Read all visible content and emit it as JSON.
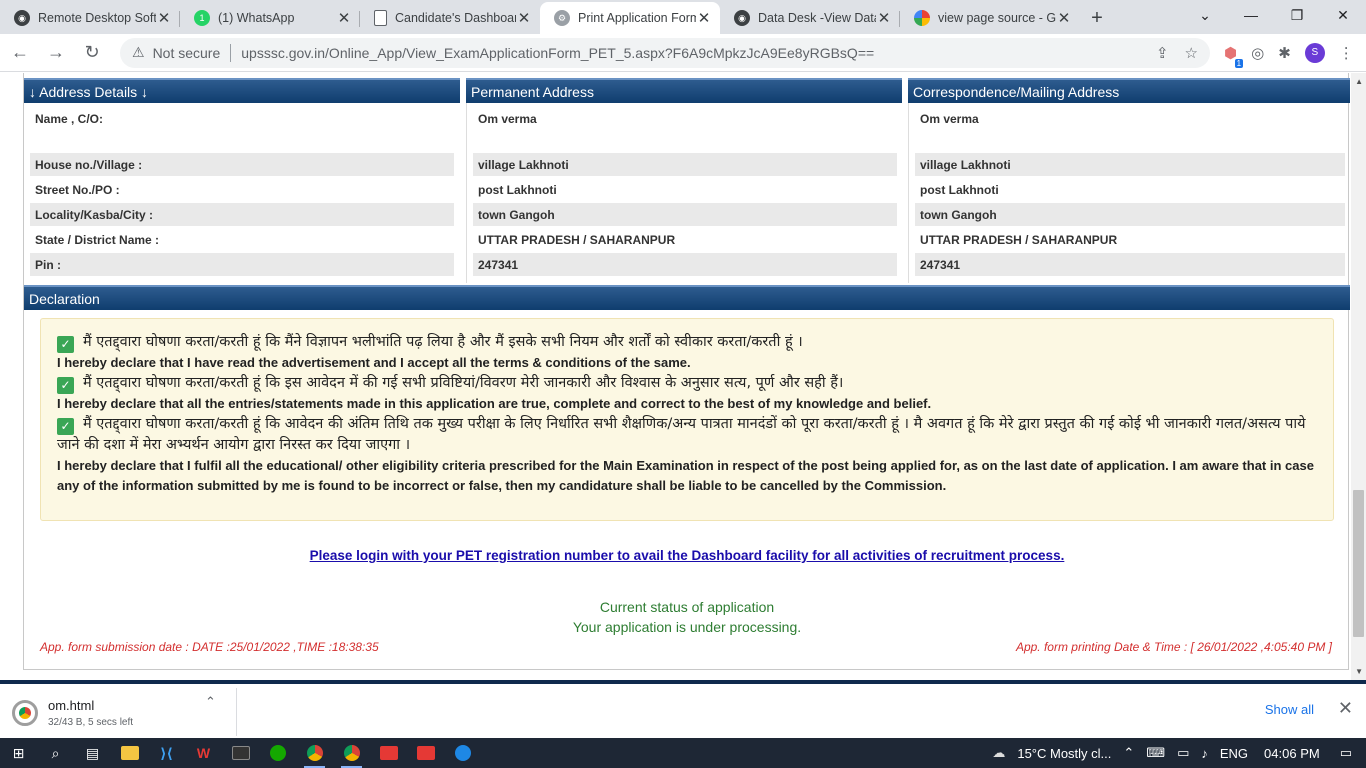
{
  "browser": {
    "tabs": [
      {
        "title": "Remote Desktop Softw",
        "icon": "remote-desktop-icon",
        "color": "#3c4043"
      },
      {
        "title": "(1) WhatsApp",
        "icon": "whatsapp-icon",
        "color": "#25d366"
      },
      {
        "title": "Candidate's Dashboar",
        "icon": "document-icon",
        "color": "#5f6368"
      },
      {
        "title": "Print Application Form",
        "icon": "print-app-icon",
        "color": "#5f6368"
      },
      {
        "title": "Data Desk -View Data",
        "icon": "remote-desktop-icon",
        "color": "#3c4043"
      },
      {
        "title": "view page source - Go",
        "icon": "google-icon",
        "color": "#4285f4"
      }
    ],
    "active_tab": 3,
    "new_tab": "+",
    "not_secure": "Not secure",
    "url": "upsssc.gov.in/Online_App/View_ExamApplicationForm_PET_5.aspx?F6A9cMpkzJcA9Ee8yRGBsQ==",
    "profile_initial": "S",
    "extension_badge": "1"
  },
  "address": {
    "headers": {
      "labels": "↓ Address Details ↓",
      "permanent": "Permanent Address",
      "correspondence": "Correspondence/Mailing Address"
    },
    "labels": [
      "Name , C/O:",
      "House no./Village :",
      "Street No./PO :",
      "Locality/Kasba/City :",
      "State / District Name :",
      "Pin :"
    ],
    "permanent": [
      "Om verma",
      "village Lakhnoti",
      "post Lakhnoti",
      "town Gangoh",
      "UTTAR PRADESH / SAHARANPUR",
      "247341"
    ],
    "correspondence": [
      "Om verma",
      "village Lakhnoti",
      "post Lakhnoti",
      "town Gangoh",
      "UTTAR PRADESH / SAHARANPUR",
      "247341"
    ]
  },
  "declaration": {
    "title": "Declaration",
    "hi1": "मैं एतद्द्वारा घोषणा करता/करती हूं कि मैंने विज्ञापन भलीभांति पढ़ लिया है और मैं इसके सभी नियम और शर्तों को स्वीकार करता/करती हूं ।",
    "en1": "I hereby declare that I have read the advertisement and I accept all the terms & conditions of the same.",
    "hi2": "मैं एतद्द्वारा घोषणा करता/करती हूं कि इस आवेदन में की गई सभी प्रविष्टियां/विवरण मेरी जानकारी और विश्वास के अनुसार सत्य, पूर्ण और सही हैं।",
    "en2": "I hereby declare that all the entries/statements made in this application are true, complete and correct to the best of my knowledge and belief.",
    "hi3": "मैं एतद्द्वारा घोषणा करता/करती हूं कि आवेदन की अंतिम तिथि तक मुख्य परीक्षा के लिए निर्धारित सभी शैक्षणिक/अन्य पात्रता मानदंडों को पूरा करता/करती हूं । मै अवगत हूं कि मेरे द्वारा प्रस्तुत की गई कोई भी जानकारी गलत/असत्य पाये जाने की दशा में मेरा अभ्यर्थन आयोग द्वारा निरस्त कर दिया जाएगा ।",
    "en3": "I hereby declare that I fulfil all the educational/ other eligibility criteria prescribed for the Main Examination in respect of the post being applied for, as on the last date of application. I am aware that in case any of the information submitted by me is found to be incorrect or false, then my candidature shall be liable to be cancelled by the Commission."
  },
  "login_link": "Please login with your PET registration number to avail the Dashboard facility for all activities of recruitment process.",
  "status": {
    "title": "Current status of application",
    "message": "Your application is under processing."
  },
  "footer": {
    "submission": "App. form submission date :    DATE :25/01/2022 ,TIME :18:38:35",
    "printing": "App. form printing Date & Time : [ 26/01/2022 ,4:05:40 PM ]"
  },
  "download": {
    "file": "om.html",
    "progress": "32/43 B, 5 secs left",
    "show_all": "Show all"
  },
  "taskbar": {
    "weather": "15°C  Mostly cl...",
    "language": "ENG",
    "time": "04:06 PM"
  },
  "colors": {
    "header_blue": "#0f3d6e",
    "declaration_bg": "#fcf8e3",
    "status_green": "#2e7d32",
    "date_red": "#d32f2f"
  }
}
